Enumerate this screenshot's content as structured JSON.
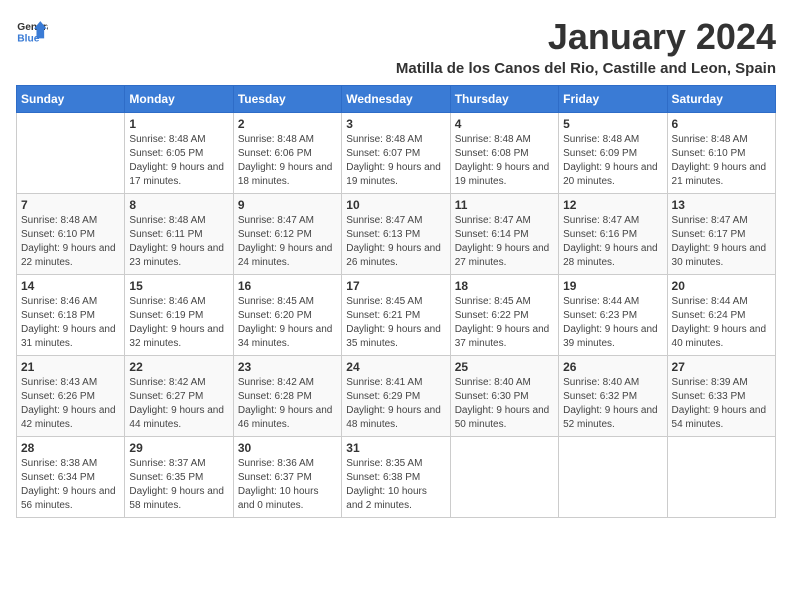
{
  "header": {
    "logo_line1": "General",
    "logo_line2": "Blue",
    "title": "January 2024",
    "subtitle": "Matilla de los Canos del Rio, Castille and Leon, Spain"
  },
  "calendar": {
    "days_of_week": [
      "Sunday",
      "Monday",
      "Tuesday",
      "Wednesday",
      "Thursday",
      "Friday",
      "Saturday"
    ],
    "weeks": [
      [
        {
          "day": "",
          "sunrise": "",
          "sunset": "",
          "daylight": ""
        },
        {
          "day": "1",
          "sunrise": "Sunrise: 8:48 AM",
          "sunset": "Sunset: 6:05 PM",
          "daylight": "Daylight: 9 hours and 17 minutes."
        },
        {
          "day": "2",
          "sunrise": "Sunrise: 8:48 AM",
          "sunset": "Sunset: 6:06 PM",
          "daylight": "Daylight: 9 hours and 18 minutes."
        },
        {
          "day": "3",
          "sunrise": "Sunrise: 8:48 AM",
          "sunset": "Sunset: 6:07 PM",
          "daylight": "Daylight: 9 hours and 19 minutes."
        },
        {
          "day": "4",
          "sunrise": "Sunrise: 8:48 AM",
          "sunset": "Sunset: 6:08 PM",
          "daylight": "Daylight: 9 hours and 19 minutes."
        },
        {
          "day": "5",
          "sunrise": "Sunrise: 8:48 AM",
          "sunset": "Sunset: 6:09 PM",
          "daylight": "Daylight: 9 hours and 20 minutes."
        },
        {
          "day": "6",
          "sunrise": "Sunrise: 8:48 AM",
          "sunset": "Sunset: 6:10 PM",
          "daylight": "Daylight: 9 hours and 21 minutes."
        }
      ],
      [
        {
          "day": "7",
          "sunrise": "Sunrise: 8:48 AM",
          "sunset": "Sunset: 6:10 PM",
          "daylight": "Daylight: 9 hours and 22 minutes."
        },
        {
          "day": "8",
          "sunrise": "Sunrise: 8:48 AM",
          "sunset": "Sunset: 6:11 PM",
          "daylight": "Daylight: 9 hours and 23 minutes."
        },
        {
          "day": "9",
          "sunrise": "Sunrise: 8:47 AM",
          "sunset": "Sunset: 6:12 PM",
          "daylight": "Daylight: 9 hours and 24 minutes."
        },
        {
          "day": "10",
          "sunrise": "Sunrise: 8:47 AM",
          "sunset": "Sunset: 6:13 PM",
          "daylight": "Daylight: 9 hours and 26 minutes."
        },
        {
          "day": "11",
          "sunrise": "Sunrise: 8:47 AM",
          "sunset": "Sunset: 6:14 PM",
          "daylight": "Daylight: 9 hours and 27 minutes."
        },
        {
          "day": "12",
          "sunrise": "Sunrise: 8:47 AM",
          "sunset": "Sunset: 6:16 PM",
          "daylight": "Daylight: 9 hours and 28 minutes."
        },
        {
          "day": "13",
          "sunrise": "Sunrise: 8:47 AM",
          "sunset": "Sunset: 6:17 PM",
          "daylight": "Daylight: 9 hours and 30 minutes."
        }
      ],
      [
        {
          "day": "14",
          "sunrise": "Sunrise: 8:46 AM",
          "sunset": "Sunset: 6:18 PM",
          "daylight": "Daylight: 9 hours and 31 minutes."
        },
        {
          "day": "15",
          "sunrise": "Sunrise: 8:46 AM",
          "sunset": "Sunset: 6:19 PM",
          "daylight": "Daylight: 9 hours and 32 minutes."
        },
        {
          "day": "16",
          "sunrise": "Sunrise: 8:45 AM",
          "sunset": "Sunset: 6:20 PM",
          "daylight": "Daylight: 9 hours and 34 minutes."
        },
        {
          "day": "17",
          "sunrise": "Sunrise: 8:45 AM",
          "sunset": "Sunset: 6:21 PM",
          "daylight": "Daylight: 9 hours and 35 minutes."
        },
        {
          "day": "18",
          "sunrise": "Sunrise: 8:45 AM",
          "sunset": "Sunset: 6:22 PM",
          "daylight": "Daylight: 9 hours and 37 minutes."
        },
        {
          "day": "19",
          "sunrise": "Sunrise: 8:44 AM",
          "sunset": "Sunset: 6:23 PM",
          "daylight": "Daylight: 9 hours and 39 minutes."
        },
        {
          "day": "20",
          "sunrise": "Sunrise: 8:44 AM",
          "sunset": "Sunset: 6:24 PM",
          "daylight": "Daylight: 9 hours and 40 minutes."
        }
      ],
      [
        {
          "day": "21",
          "sunrise": "Sunrise: 8:43 AM",
          "sunset": "Sunset: 6:26 PM",
          "daylight": "Daylight: 9 hours and 42 minutes."
        },
        {
          "day": "22",
          "sunrise": "Sunrise: 8:42 AM",
          "sunset": "Sunset: 6:27 PM",
          "daylight": "Daylight: 9 hours and 44 minutes."
        },
        {
          "day": "23",
          "sunrise": "Sunrise: 8:42 AM",
          "sunset": "Sunset: 6:28 PM",
          "daylight": "Daylight: 9 hours and 46 minutes."
        },
        {
          "day": "24",
          "sunrise": "Sunrise: 8:41 AM",
          "sunset": "Sunset: 6:29 PM",
          "daylight": "Daylight: 9 hours and 48 minutes."
        },
        {
          "day": "25",
          "sunrise": "Sunrise: 8:40 AM",
          "sunset": "Sunset: 6:30 PM",
          "daylight": "Daylight: 9 hours and 50 minutes."
        },
        {
          "day": "26",
          "sunrise": "Sunrise: 8:40 AM",
          "sunset": "Sunset: 6:32 PM",
          "daylight": "Daylight: 9 hours and 52 minutes."
        },
        {
          "day": "27",
          "sunrise": "Sunrise: 8:39 AM",
          "sunset": "Sunset: 6:33 PM",
          "daylight": "Daylight: 9 hours and 54 minutes."
        }
      ],
      [
        {
          "day": "28",
          "sunrise": "Sunrise: 8:38 AM",
          "sunset": "Sunset: 6:34 PM",
          "daylight": "Daylight: 9 hours and 56 minutes."
        },
        {
          "day": "29",
          "sunrise": "Sunrise: 8:37 AM",
          "sunset": "Sunset: 6:35 PM",
          "daylight": "Daylight: 9 hours and 58 minutes."
        },
        {
          "day": "30",
          "sunrise": "Sunrise: 8:36 AM",
          "sunset": "Sunset: 6:37 PM",
          "daylight": "Daylight: 10 hours and 0 minutes."
        },
        {
          "day": "31",
          "sunrise": "Sunrise: 8:35 AM",
          "sunset": "Sunset: 6:38 PM",
          "daylight": "Daylight: 10 hours and 2 minutes."
        },
        {
          "day": "",
          "sunrise": "",
          "sunset": "",
          "daylight": ""
        },
        {
          "day": "",
          "sunrise": "",
          "sunset": "",
          "daylight": ""
        },
        {
          "day": "",
          "sunrise": "",
          "sunset": "",
          "daylight": ""
        }
      ]
    ]
  }
}
